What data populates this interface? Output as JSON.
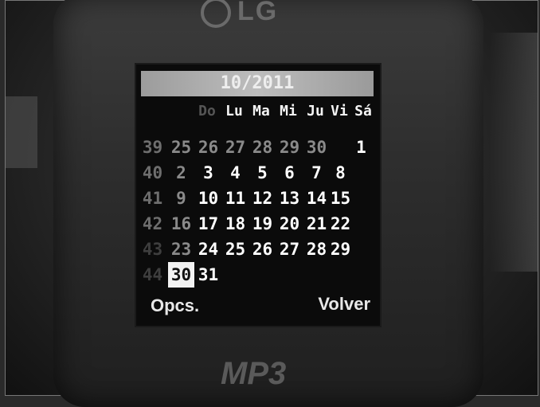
{
  "brand": {
    "logo_text": "LG"
  },
  "calendar": {
    "month_label": "10/2011",
    "weekdays": [
      "Do",
      "Lu",
      "Ma",
      "Mi",
      "Ju",
      "Vi",
      "Sá"
    ],
    "weeks": [
      {
        "week": "39",
        "days": [
          "25",
          "26",
          "27",
          "28",
          "29",
          "30",
          "1"
        ]
      },
      {
        "week": "40",
        "days": [
          "2",
          "3",
          "4",
          "5",
          "6",
          "7",
          "8"
        ]
      },
      {
        "week": "41",
        "days": [
          "9",
          "10",
          "11",
          "12",
          "13",
          "14",
          "15"
        ]
      },
      {
        "week": "42",
        "days": [
          "16",
          "17",
          "18",
          "19",
          "20",
          "21",
          "22"
        ]
      },
      {
        "week": "43",
        "days": [
          "23",
          "24",
          "25",
          "26",
          "27",
          "28",
          "29"
        ]
      },
      {
        "week": "44",
        "days": [
          "30",
          "31",
          "",
          "",
          "",
          "",
          ""
        ]
      }
    ],
    "selected_day": "30"
  },
  "softkeys": {
    "left": "Opcs.",
    "right": "Volver"
  },
  "device_label": "MP3"
}
